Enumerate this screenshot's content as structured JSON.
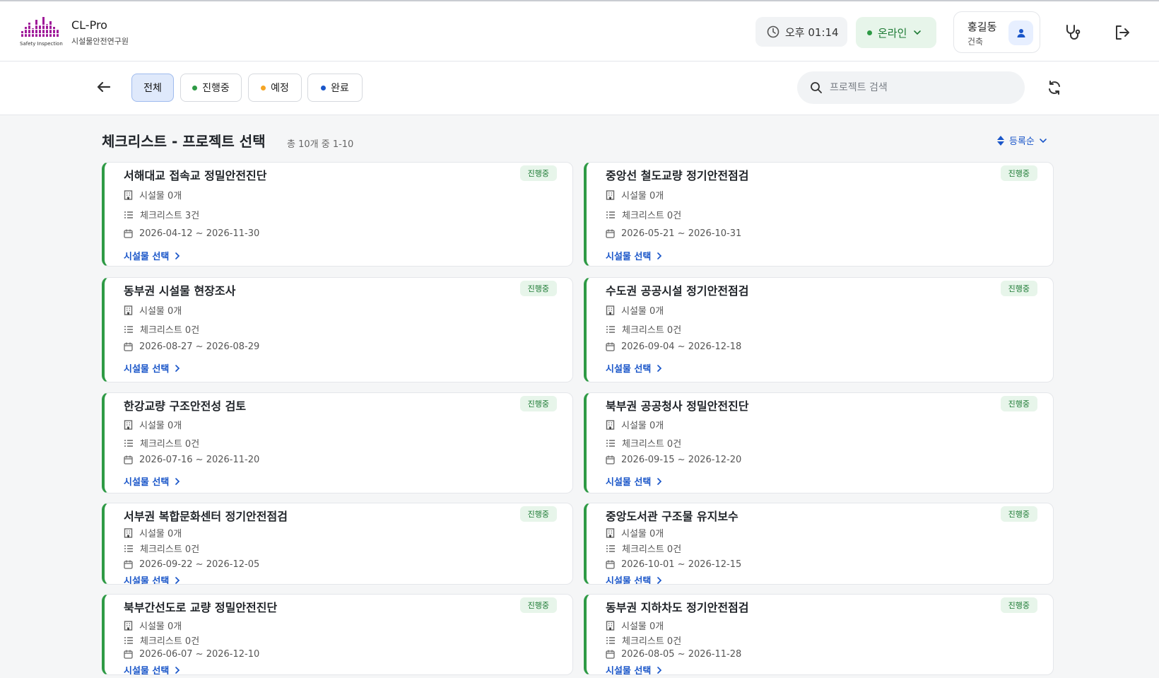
{
  "header": {
    "logo_text": "Safety Inspection",
    "brand_name": "CL-Pro",
    "org_name": "시설물안전연구원",
    "time": "오후 01:14",
    "status": "온라인",
    "user_name": "홍길동",
    "user_role": "건축"
  },
  "toolbar": {
    "filters": [
      {
        "label": "전체"
      },
      {
        "label": "진행중"
      },
      {
        "label": "예정"
      },
      {
        "label": "완료"
      }
    ],
    "search_placeholder": "프로젝트 검색"
  },
  "colors": {
    "in_progress": "#2e9a45",
    "planned": "#f5a524",
    "done": "#1a56c9",
    "accent": "#1a56c9"
  },
  "main": {
    "title": "체크리스트 - 프로젝트 선택",
    "count_text": "총 10개 중 1-10",
    "sort_label": "등록순",
    "select_label": "시설물 선택",
    "projects": [
      {
        "name": "서해대교 접속교 정밀안전진단",
        "status": "진행중",
        "facilities": "시설물 0개",
        "checklists": "체크리스트 3건",
        "period": "2026-04-12 ~ 2026-11-30"
      },
      {
        "name": "중앙선 철도교량 정기안전점검",
        "status": "진행중",
        "facilities": "시설물 0개",
        "checklists": "체크리스트 0건",
        "period": "2026-05-21 ~ 2026-10-31"
      },
      {
        "name": "동부권 시설물 현장조사",
        "status": "진행중",
        "facilities": "시설물 0개",
        "checklists": "체크리스트 0건",
        "period": "2026-08-27 ~ 2026-08-29"
      },
      {
        "name": "수도권 공공시설 정기안전점검",
        "status": "진행중",
        "facilities": "시설물 0개",
        "checklists": "체크리스트 0건",
        "period": "2026-09-04 ~ 2026-12-18"
      },
      {
        "name": "한강교량 구조안전성 검토",
        "status": "진행중",
        "facilities": "시설물 0개",
        "checklists": "체크리스트 0건",
        "period": "2026-07-16 ~ 2026-11-20"
      },
      {
        "name": "북부권 공공청사 정밀안전진단",
        "status": "진행중",
        "facilities": "시설물 0개",
        "checklists": "체크리스트 0건",
        "period": "2026-09-15 ~ 2026-12-20"
      },
      {
        "name": "서부권 복합문화센터 정기안전점검",
        "status": "진행중",
        "facilities": "시설물 0개",
        "checklists": "체크리스트 0건",
        "period": "2026-09-22 ~ 2026-12-05"
      },
      {
        "name": "중앙도서관 구조물 유지보수",
        "status": "진행중",
        "facilities": "시설물 0개",
        "checklists": "체크리스트 0건",
        "period": "2026-10-01 ~ 2026-12-15"
      },
      {
        "name": "북부간선도로 교량 정밀안전진단",
        "status": "진행중",
        "facilities": "시설물 0개",
        "checklists": "체크리스트 0건",
        "period": "2026-06-07 ~ 2026-12-10"
      },
      {
        "name": "동부권 지하차도 정기안전점검",
        "status": "진행중",
        "facilities": "시설물 0개",
        "checklists": "체크리스트 0건",
        "period": "2026-08-05 ~ 2026-11-28"
      }
    ]
  }
}
